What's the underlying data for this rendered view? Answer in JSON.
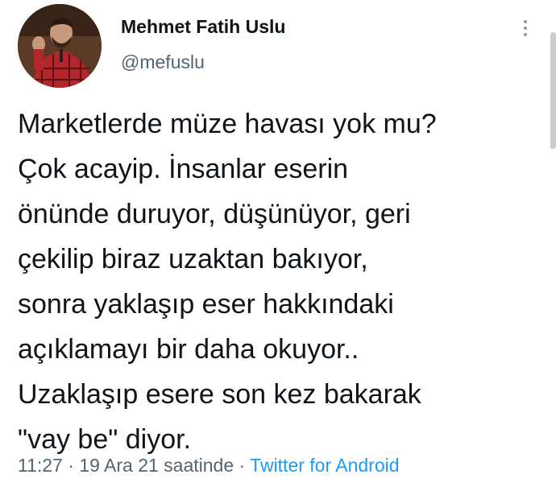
{
  "author": {
    "name": "Mehmet Fatih Uslu",
    "handle": "@mefuslu",
    "avatar_icon": "profile-photo"
  },
  "more_icon": "vertical-ellipsis-icon",
  "tweet": {
    "lines": [
      "Marketlerde müze havası yok mu?",
      "Çok acayip. İnsanlar eserin",
      "önünde duruyor, düşünüyor, geri",
      "çekilip biraz uzaktan bakıyor,",
      "sonra yaklaşıp eser hakkındaki",
      "açıklamayı bir daha okuyor..",
      "Uzaklaşıp esere son kez bakarak",
      "\"vay be\" diyor."
    ]
  },
  "meta": {
    "time": "11:27",
    "separator": " · ",
    "date": "19 Ara 21 saatinde",
    "source": "Twitter for Android"
  },
  "colors": {
    "text": "#0f1419",
    "secondary": "#536471",
    "link": "#1d9bf0"
  }
}
